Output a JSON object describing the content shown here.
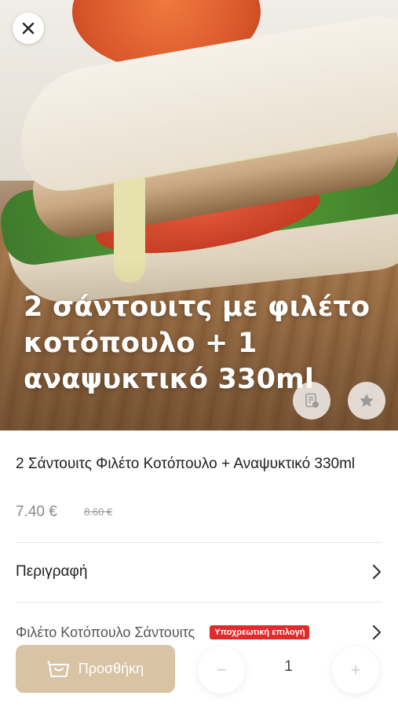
{
  "hero": {
    "promo_text": "2 σάντουιτς με φιλέτο κοτόπουλο + 1 αναψυκτικό 330ml"
  },
  "product": {
    "title": "2 Σάντουιτς Φιλέτο Κοτόπουλο + Αναψυκτικό 330ml",
    "price": "7.40 €",
    "old_price": "8.60 €"
  },
  "rows": {
    "description_label": "Περιγραφή",
    "option_label": "Φιλέτο Κοτόπουλο Σάντουιτς",
    "option_badge": "Υποχρεωτική επιλογή"
  },
  "cart": {
    "add_label": "Προσθήκη",
    "minus_label": "−",
    "plus_label": "+",
    "quantity": "1"
  },
  "colors": {
    "badge_red": "#e02b2b",
    "add_button": "#d8c3a4"
  },
  "icons": [
    "close-icon",
    "menu-icon",
    "star-icon",
    "chevron-right-icon",
    "basket-icon"
  ]
}
